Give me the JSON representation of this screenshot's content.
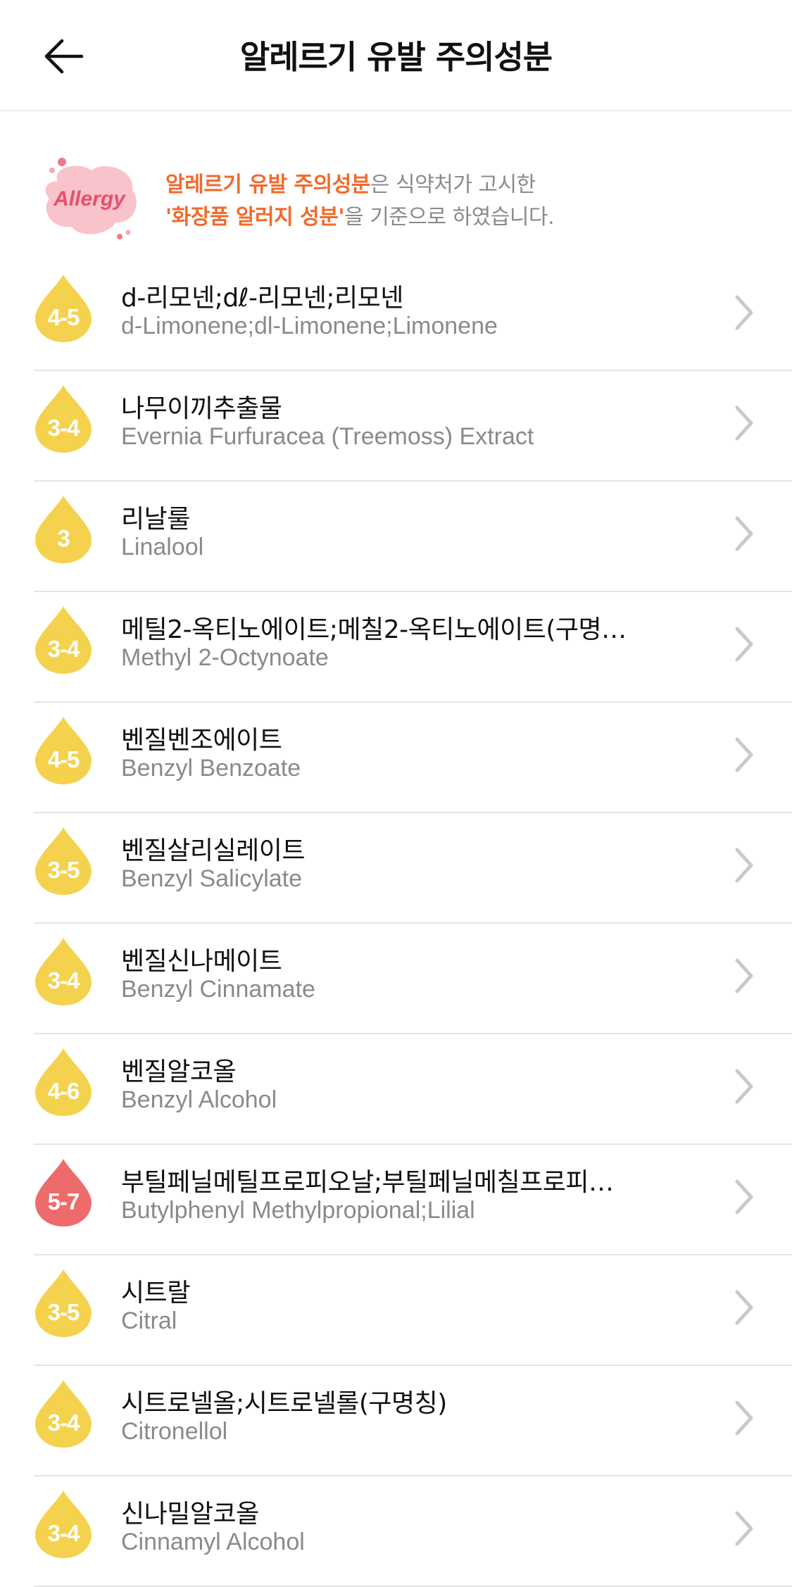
{
  "header": {
    "title": "알레르기 유발 주의성분",
    "back_icon": "arrow-left-icon"
  },
  "notice": {
    "badge_text": "Allergy",
    "line1_highlight": "알레르기 유발 주의성분",
    "line1_rest": "은 식약처가 고시한",
    "line2_highlight": "'화장품 알러지 성분'",
    "line2_rest": "을 기준으로 하였습니다.",
    "colors": {
      "highlight": "#f26a2a",
      "badge_pink": "#f7a8b4",
      "badge_text": "#e8506a"
    }
  },
  "colors": {
    "yellow_drop": "#f5d24e",
    "red_drop": "#ee6b6b",
    "chevron": "#c9c9c9"
  },
  "ingredients": [
    {
      "score": "4-5",
      "ko": "d-리모넨;dℓ-리모넨;리모넨",
      "en": "d-Limonene;dl-Limonene;Limonene",
      "level": "yellow"
    },
    {
      "score": "3-4",
      "ko": "나무이끼추출물",
      "en": "Evernia Furfuracea (Treemoss) Extract",
      "level": "yellow"
    },
    {
      "score": "3",
      "ko": "리날룰",
      "en": "Linalool",
      "level": "yellow"
    },
    {
      "score": "3-4",
      "ko": "메틸2-옥티노에이트;메칠2-옥티노에이트(구명…",
      "en": "Methyl 2-Octynoate",
      "level": "yellow"
    },
    {
      "score": "4-5",
      "ko": "벤질벤조에이트",
      "en": "Benzyl Benzoate",
      "level": "yellow"
    },
    {
      "score": "3-5",
      "ko": "벤질살리실레이트",
      "en": "Benzyl Salicylate",
      "level": "yellow"
    },
    {
      "score": "3-4",
      "ko": "벤질신나메이트",
      "en": "Benzyl Cinnamate",
      "level": "yellow"
    },
    {
      "score": "4-6",
      "ko": "벤질알코올",
      "en": "Benzyl Alcohol",
      "level": "yellow"
    },
    {
      "score": "5-7",
      "ko": "부틸페닐메틸프로피오날;부틸페닐메칠프로피…",
      "en": "Butylphenyl Methylpropional;Lilial",
      "level": "red"
    },
    {
      "score": "3-5",
      "ko": "시트랄",
      "en": "Citral",
      "level": "yellow"
    },
    {
      "score": "3-4",
      "ko": "시트로넬올;시트로넬롤(구명칭)",
      "en": "Citronellol",
      "level": "yellow"
    },
    {
      "score": "3-4",
      "ko": "신나밀알코올",
      "en": "Cinnamyl Alcohol",
      "level": "yellow"
    }
  ]
}
